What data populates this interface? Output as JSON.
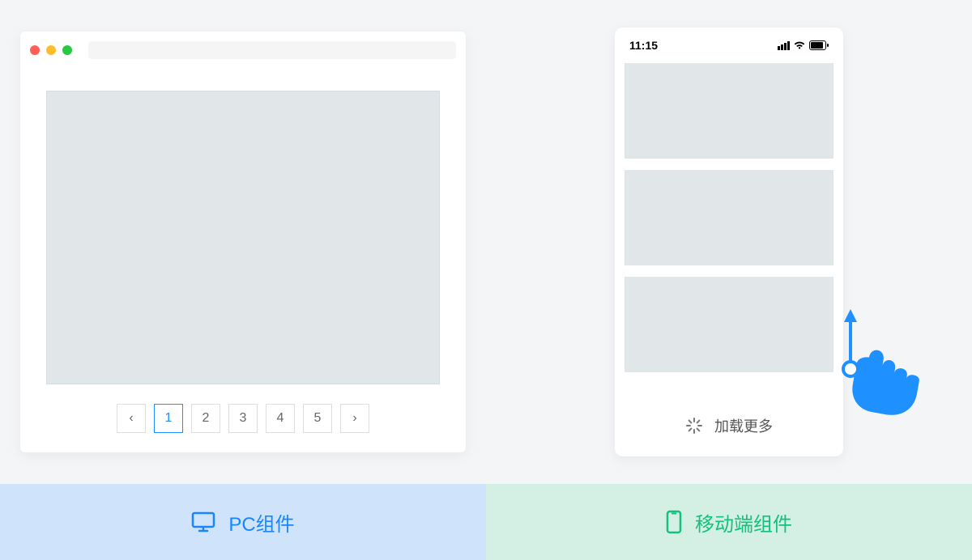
{
  "pc": {
    "pagination": {
      "prev": "‹",
      "pages": [
        "1",
        "2",
        "3",
        "4",
        "5"
      ],
      "next": "›",
      "active": 0
    }
  },
  "mobile": {
    "time": "11:15",
    "loadMore": "加载更多"
  },
  "labels": {
    "pc": "PC组件",
    "mobile": "移动端组件"
  }
}
